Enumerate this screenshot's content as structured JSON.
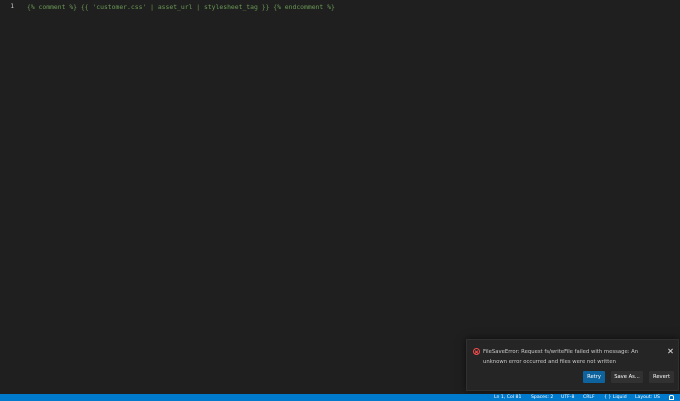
{
  "editor": {
    "line_number": "1",
    "code": "{% comment %} {{ 'customer.css' | asset_url | stylesheet_tag }} {% endcomment %}"
  },
  "notification": {
    "icon": "error-icon",
    "message": "FileSaveError: Request fs/writeFile failed with message: An unknown error occurred and files were not written",
    "buttons": {
      "retry": "Retry",
      "save_as": "Save As...",
      "revert": "Revert"
    },
    "colors": {
      "error": "#f14c4c",
      "primary_button": "#0e639c"
    }
  },
  "statusbar": {
    "position": "Ln 1, Col 81",
    "spaces": "Spaces: 2",
    "encoding": "UTF-8",
    "eol": "CRLF",
    "language": "{ } Liquid",
    "layout": "Layout: US",
    "color": "#007acc"
  }
}
